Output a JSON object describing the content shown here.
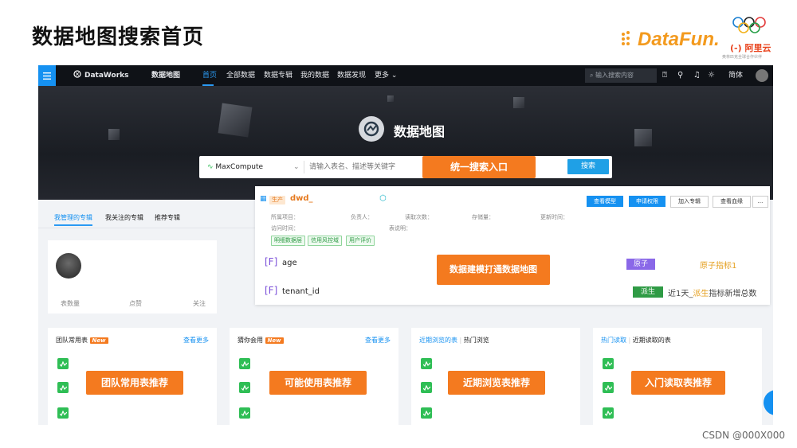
{
  "slide": {
    "title": "数据地图搜索首页",
    "datafun_logo": "DataFun.",
    "aliyun_logo": "阿里云",
    "aliyun_sub": "奥林匹克全球合作伙伴",
    "credit": "CSDN @000X000"
  },
  "topnav": {
    "brand": "DataWorks",
    "module": "数据地图",
    "items": [
      "首页",
      "全部数据",
      "数据专辑",
      "我的数据",
      "数据发现",
      "更多"
    ],
    "search_placeholder": "输入搜索内容",
    "lang": "简体",
    "icons": [
      "help-icon",
      "link-icon",
      "bell-icon",
      "bug-icon"
    ]
  },
  "hero": {
    "title": "数据地图",
    "engine": "MaxCompute",
    "search_placeholder": "请输入表名、描述等关键字",
    "search_button": "搜索",
    "callout": "统一搜索入口"
  },
  "album_tabs": [
    "我管理的专辑",
    "我关注的专辑",
    "推荐专辑"
  ],
  "profile": {
    "stats": [
      "表数量",
      "点赞",
      "关注"
    ]
  },
  "detail": {
    "env_tag": "生产",
    "table_name": "dwd_",
    "buttons": [
      "查看模型",
      "申请权限",
      "加入专辑",
      "查看血缘",
      "..."
    ],
    "meta_row1": [
      "所属项目：",
      "负责人：",
      "读取次数：",
      "存储量：",
      "更新时间："
    ],
    "meta_row2": [
      "访问时间：",
      "表说明："
    ],
    "tags": [
      "明细数据层",
      "信用风控域",
      "用户评价"
    ],
    "fields": [
      {
        "name": "age",
        "badge": "原子",
        "indicator": "原子指标1"
      },
      {
        "name": "tenant_id",
        "badge": "派生",
        "indicator_prefix": "近1天_",
        "indicator_hl": "派生",
        "indicator_suffix": "指标新增总数"
      }
    ],
    "callout": "数据建模打通数据地图"
  },
  "cards": [
    {
      "title": "团队常用表",
      "new": "New",
      "more": "查看更多",
      "callout": "团队常用表推荐"
    },
    {
      "title": "猜你会用",
      "new": "New",
      "more": "查看更多",
      "callout": "可能使用表推荐"
    },
    {
      "tab1": "近期浏览的表",
      "tab2": "热门浏览",
      "callout": "近期浏览表推荐"
    },
    {
      "tab1": "热门读取",
      "tab2": "近期读取的表",
      "callout": "入门读取表推荐"
    }
  ],
  "colors": {
    "accent_blue": "#1591f1",
    "callout_orange": "#f47a1f",
    "nav_bg": "#0f1217",
    "atom_purple": "#8a68e8",
    "derive_green": "#2f9b45"
  }
}
